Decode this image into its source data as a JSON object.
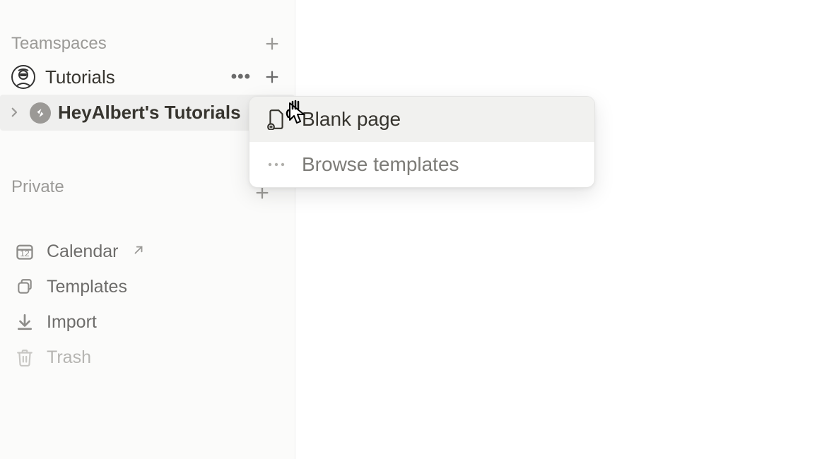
{
  "teamspaces": {
    "header": "Teamspaces",
    "workspace": {
      "name": "Tutorials"
    },
    "page": {
      "name": "HeyAlbert's Tutorials"
    }
  },
  "private": {
    "header": "Private"
  },
  "bottom": {
    "calendar": {
      "label": "Calendar",
      "day": "12"
    },
    "templates": {
      "label": "Templates"
    },
    "import": {
      "label": "Import"
    },
    "trash": {
      "label": "Trash"
    }
  },
  "popup": {
    "blank": "Blank page",
    "browse": "Browse templates"
  }
}
